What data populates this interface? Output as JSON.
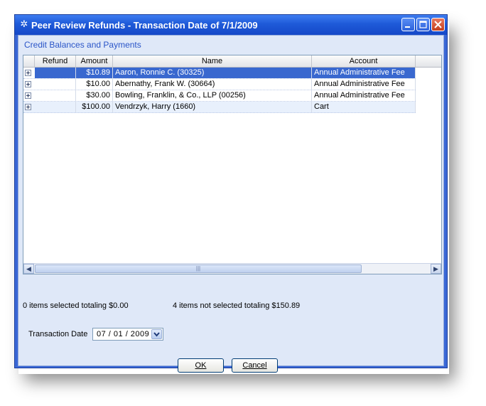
{
  "window": {
    "title": "Peer Review Refunds - Transaction Date of 7/1/2009",
    "colors": {
      "titlebar": "#1e5ad8",
      "selection": "#3968cf",
      "group_title": "#2a55c8"
    }
  },
  "group": {
    "title": "Credit Balances and Payments"
  },
  "grid": {
    "columns": [
      "Refund",
      "Amount",
      "Name",
      "Account"
    ],
    "rows": [
      {
        "refund": "",
        "amount": "$10.89",
        "name": "Aaron, Ronnie C. (30325)",
        "account": "Annual Administrative Fee",
        "selected": true
      },
      {
        "refund": "",
        "amount": "$10.00",
        "name": "Abernathy, Frank W. (30664)",
        "account": "Annual Administrative Fee",
        "selected": false
      },
      {
        "refund": "",
        "amount": "$30.00",
        "name": "Bowling, Franklin, & Co., LLP (00256)",
        "account": "Annual Administrative Fee",
        "selected": false
      },
      {
        "refund": "",
        "amount": "$100.00",
        "name": "Vendrzyk, Harry (1660)",
        "account": "Cart",
        "selected": false
      }
    ]
  },
  "status": {
    "selected_text": "0 items selected totaling $0.00",
    "not_selected_text": "4 items not selected totaling $150.89"
  },
  "transaction_date": {
    "label": "Transaction Date",
    "value": "07 / 01 / 2009"
  },
  "buttons": {
    "ok": "OK",
    "cancel": "Cancel"
  },
  "scrollbar": {
    "left_arrow": "◀",
    "right_arrow": "▶",
    "grip": "|||"
  }
}
